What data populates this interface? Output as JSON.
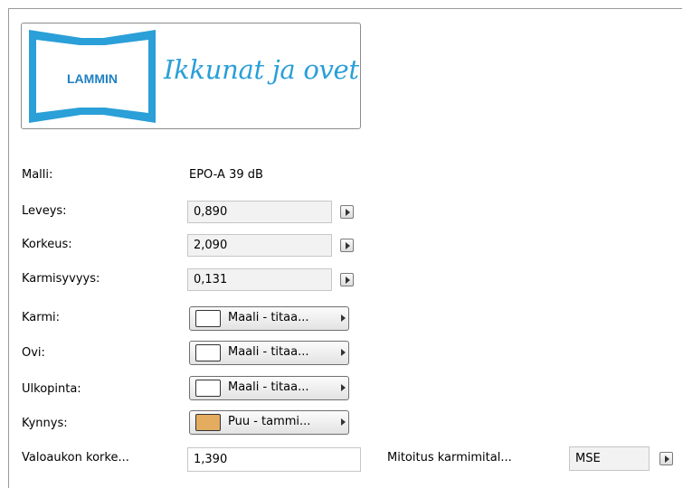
{
  "logo": {
    "brand": "LAMMIN",
    "tagline": "Ikkunat ja ovet",
    "colors": {
      "frame": "#2a9fd8",
      "brand_text": "#1f7fc0"
    }
  },
  "fields": {
    "malli": {
      "label": "Malli:",
      "value": "EPO-A 39 dB"
    },
    "leveys": {
      "label": "Leveys:",
      "value": "0,890"
    },
    "korkeus": {
      "label": "Korkeus:",
      "value": "2,090"
    },
    "karmisyvyys": {
      "label": "Karmisyvyys:",
      "value": "0,131"
    },
    "karmi": {
      "label": "Karmi:",
      "material": "Maali - titaa...",
      "swatch": "#ffffff"
    },
    "ovi": {
      "label": "Ovi:",
      "material": "Maali - titaa...",
      "swatch": "#ffffff"
    },
    "ulkopinta": {
      "label": "Ulkopinta:",
      "material": "Maali - titaa...",
      "swatch": "#ffffff"
    },
    "kynnys": {
      "label": "Kynnys:",
      "material": "Puu - tammi...",
      "swatch": "#e3ac5f"
    },
    "valoaukko": {
      "label": "Valoaukon korke...",
      "value": "1,390"
    },
    "mitoitus": {
      "label": "Mitoitus karmimital...",
      "value": "MSE"
    }
  },
  "icons": {
    "arrow": "play-arrow-icon"
  }
}
